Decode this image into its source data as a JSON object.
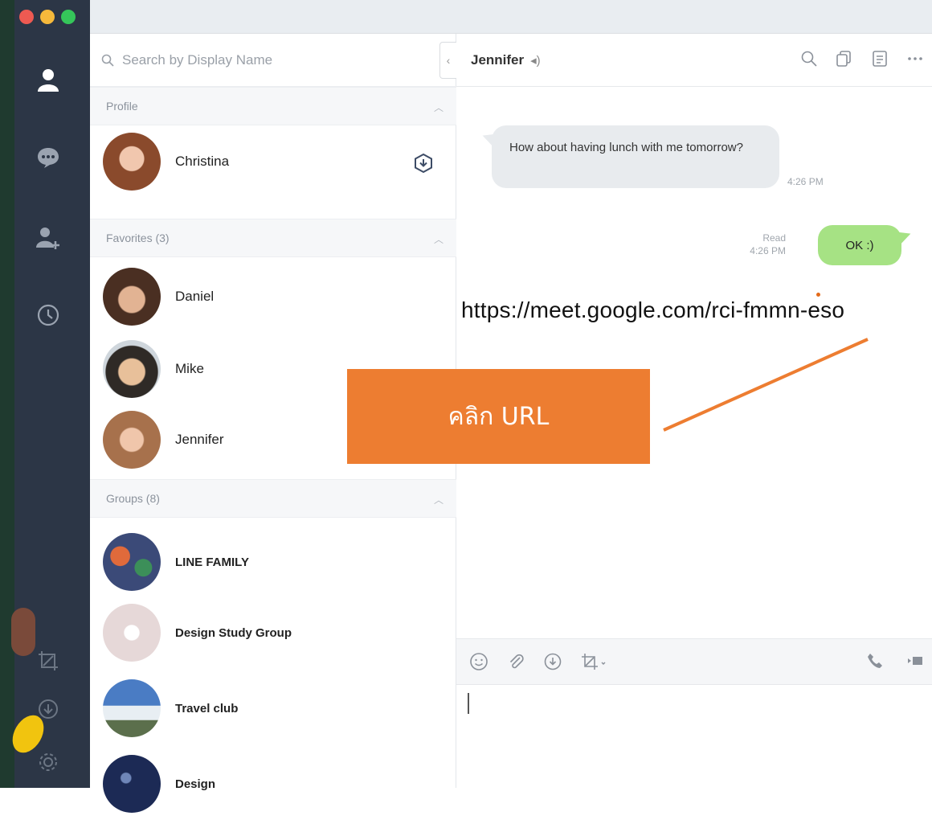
{
  "window": {
    "traffic_lights": [
      "close",
      "minimize",
      "zoom"
    ]
  },
  "rail": {
    "items": [
      {
        "icon": "friends-icon"
      },
      {
        "icon": "chats-icon"
      },
      {
        "icon": "add-friend-icon"
      },
      {
        "icon": "clock-icon"
      },
      {
        "icon": "screenshot-icon"
      },
      {
        "icon": "download-icon"
      },
      {
        "icon": "settings-icon"
      }
    ]
  },
  "search": {
    "placeholder": "Search by Display Name"
  },
  "sections": {
    "profile": "Profile",
    "favorites": "Favorites (3)",
    "groups": "Groups (8)"
  },
  "profile": {
    "name": "Christina"
  },
  "favorites": [
    {
      "name": "Daniel"
    },
    {
      "name": "Mike"
    },
    {
      "name": "Jennifer"
    }
  ],
  "groups": [
    {
      "name": "LINE FAMILY"
    },
    {
      "name": "Design Study Group"
    },
    {
      "name": "Travel club"
    },
    {
      "name": "Design"
    }
  ],
  "chat": {
    "title": "Jennifer",
    "messages": [
      {
        "direction": "in",
        "text": "How about having lunch with me tomorrow?",
        "time": "4:26 PM"
      },
      {
        "direction": "out",
        "text": "OK :)",
        "status": "Read",
        "time": "4:26 PM"
      }
    ],
    "url": "https://meet.google.com/rci-fmmn-eso"
  },
  "annotation": {
    "label": "คลิก URL",
    "color": "#ed7d31"
  },
  "colors": {
    "sidebar": "#2c3646",
    "outgoing_bubble": "#a6e284",
    "incoming_bubble": "#e8ebee"
  }
}
